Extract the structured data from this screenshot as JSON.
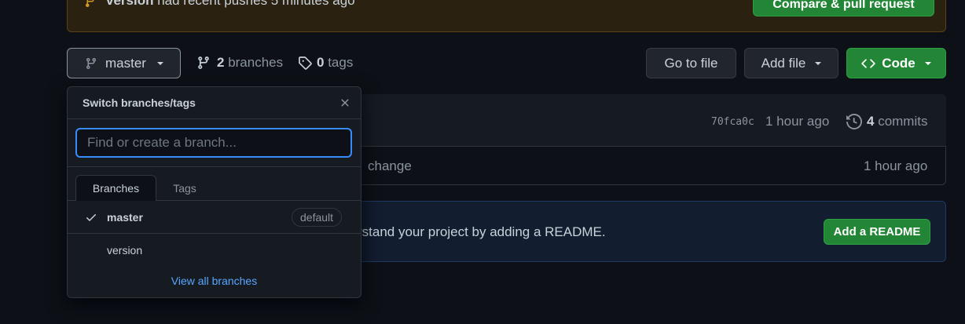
{
  "banner": {
    "branch": "version",
    "message": " had recent pushes 5 minutes ago",
    "compare_label": "Compare & pull request"
  },
  "toolbar": {
    "current_branch": "master",
    "branches_count": "2",
    "branches_label": " branches",
    "tags_count": "0",
    "tags_label": " tags",
    "go_to_file": "Go to file",
    "add_file": "Add file",
    "code": "Code"
  },
  "commit": {
    "sha": "70fca0c",
    "time": "1 hour ago",
    "commits_count": "4",
    "commits_label": " commits",
    "file_message": "change",
    "file_time": "1 hour ago"
  },
  "readme": {
    "text": "rstand your project by adding a README.",
    "button": "Add a README"
  },
  "dropdown": {
    "title": "Switch branches/tags",
    "search_placeholder": "Find or create a branch...",
    "tabs": [
      "Branches",
      "Tags"
    ],
    "branches": [
      {
        "name": "master",
        "badge": "default",
        "selected": true
      },
      {
        "name": "version",
        "selected": false
      }
    ],
    "view_all": "View all branches"
  },
  "colors": {
    "background": "#0d1117",
    "accent_green": "#238636",
    "link_blue": "#58a6ff",
    "banner_bg": "#2b2111"
  },
  "icons": [
    "git-branch-icon",
    "tag-icon",
    "history-icon",
    "close-icon",
    "check-icon",
    "code-icon"
  ]
}
